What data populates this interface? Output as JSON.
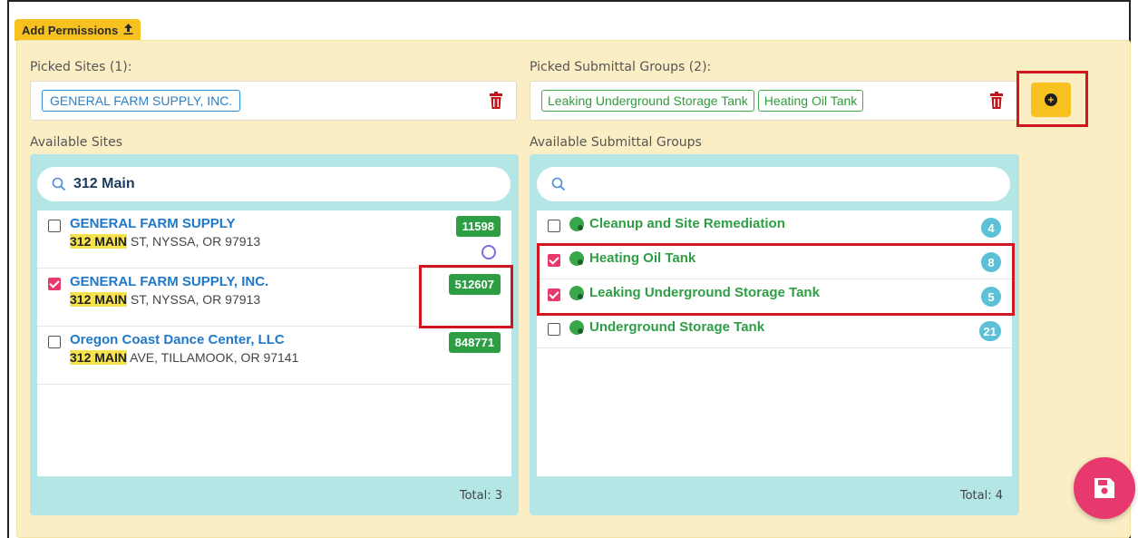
{
  "header": {
    "add_permissions_label": "Add Permissions"
  },
  "picked_sites": {
    "label": "Picked Sites (1):",
    "chips": [
      "GENERAL FARM SUPPLY, INC."
    ]
  },
  "picked_groups": {
    "label": "Picked Submittal Groups (2):",
    "chips": [
      "Leaking Underground Storage Tank",
      "Heating Oil Tank"
    ]
  },
  "available_sites": {
    "label": "Available Sites",
    "search_value": "312 Main",
    "total": "Total: 3",
    "items": [
      {
        "name": "GENERAL FARM SUPPLY",
        "addr_hl": "312 MAIN",
        "addr_rest": " ST, NYSSA, OR 97913",
        "id": "11598",
        "checked": false,
        "icon": "purple-cloud-icon"
      },
      {
        "name": "GENERAL FARM SUPPLY, INC.",
        "addr_hl": "312 MAIN",
        "addr_rest": " ST, NYSSA, OR 97913",
        "id": "512607",
        "checked": true,
        "icon": "green-globe-icon"
      },
      {
        "name": "Oregon Coast Dance Center, LLC",
        "addr_hl": "312 MAIN",
        "addr_rest": " AVE, TILLAMOOK, OR 97141",
        "id": "848771",
        "checked": false,
        "icon": "green-globe-icon"
      }
    ]
  },
  "available_groups": {
    "label": "Available Submittal Groups",
    "search_value": "",
    "total": "Total: 4",
    "items": [
      {
        "name": "Cleanup and Site Remediation",
        "count": "4",
        "checked": false
      },
      {
        "name": "Heating Oil Tank",
        "count": "8",
        "checked": true
      },
      {
        "name": "Leaking Underground Storage Tank",
        "count": "5",
        "checked": true
      },
      {
        "name": "Underground Storage Tank",
        "count": "21",
        "checked": false
      }
    ]
  },
  "colors": {
    "panel_bg": "#fbeec4",
    "accent_yellow": "#f7c21f",
    "list_bg": "#b5e6e6",
    "site_blue": "#1f78c8",
    "group_green": "#2e9e45",
    "checked_pink": "#e9386b",
    "highlight_red": "#d0161e"
  }
}
